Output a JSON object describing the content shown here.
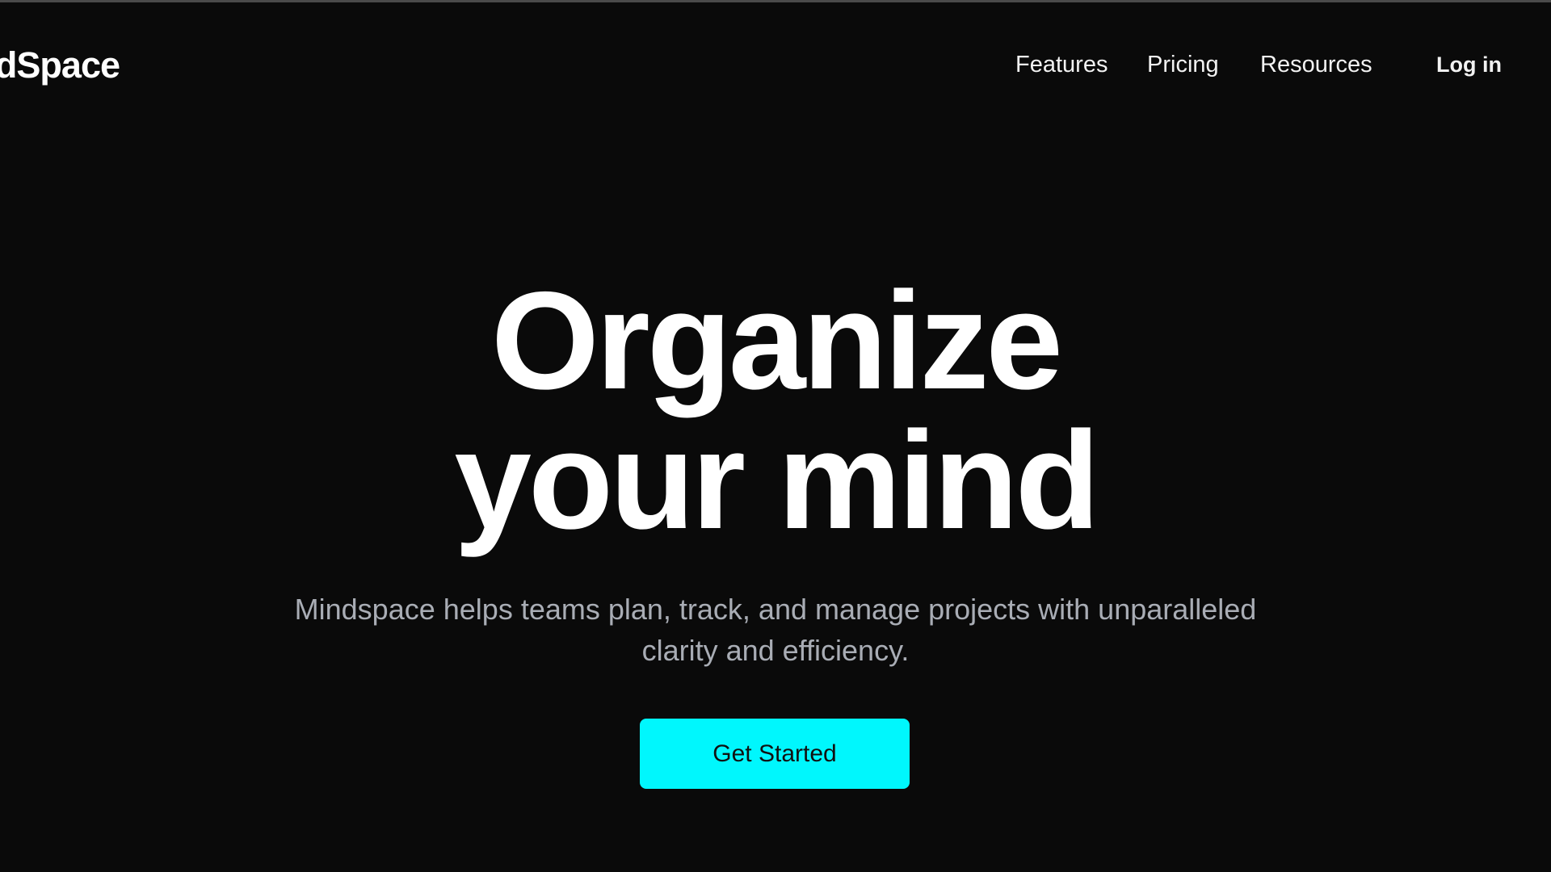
{
  "brand": {
    "logo_text": "dSpace"
  },
  "nav": {
    "features": "Features",
    "pricing": "Pricing",
    "resources": "Resources",
    "login": "Log in"
  },
  "hero": {
    "headline_line1": "Organize",
    "headline_line2": "your mind",
    "subtitle": "Mindspace helps teams plan, track, and manage projects with unparalleled clarity and efficiency.",
    "cta_label": "Get Started"
  },
  "colors": {
    "background": "#0a0a0a",
    "accent": "#00f7fd",
    "subtitle_text": "#a9adb5"
  }
}
